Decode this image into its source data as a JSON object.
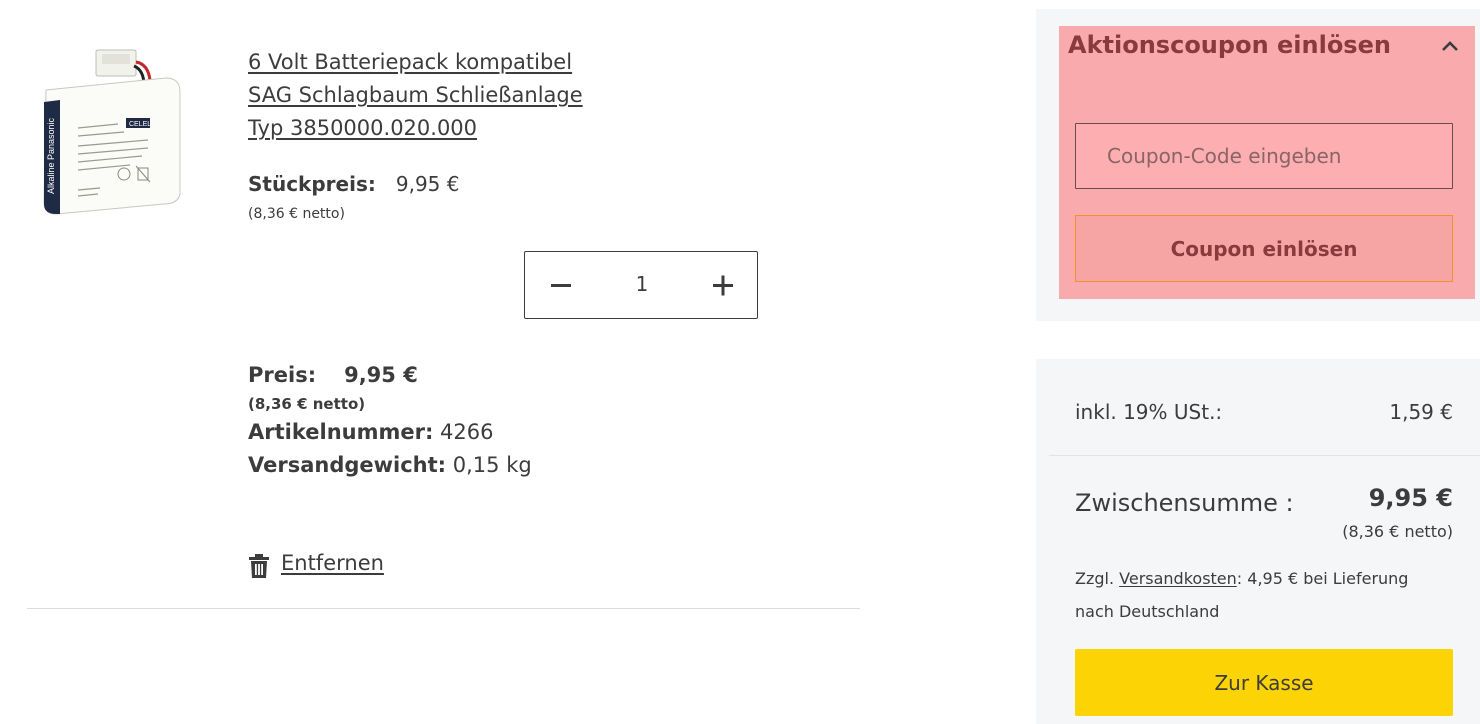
{
  "cart_item": {
    "title": "6 Volt Batteriepack kompatibel SAG Schlagbaum Schließanlage Typ 3850000.020.000",
    "image_label": "CELEL",
    "image_brand": "Alkaline Panasonic",
    "unit_price_label": "Stückpreis:",
    "unit_price_value": "9,95 €",
    "unit_price_net": "(8,36 € netto)",
    "quantity": {
      "minus_symbol": "−",
      "value": "1",
      "plus_symbol": "+"
    },
    "price_label": "Preis:",
    "price_value": "9,95 €",
    "price_net": "(8,36 € netto)",
    "article_number_label": "Artikelnummer:",
    "article_number_value": "4266",
    "shipping_weight_label": "Versandgewicht:",
    "shipping_weight_value": "0,15 kg",
    "remove_label": "Entfernen",
    "remove_icon": "trash-icon"
  },
  "coupon": {
    "title": "Aktionscoupon einlösen",
    "toggle_icon": "chevron-up-icon",
    "input_placeholder": "Coupon-Code eingeben",
    "input_value": "",
    "button_label": "Coupon einlösen"
  },
  "summary": {
    "tax_label": "inkl. 19% USt.:",
    "tax_value": "1,59 €",
    "subtotal_label": "Zwischensumme :",
    "subtotal_value": "9,95 €",
    "subtotal_net": "(8,36 € netto)",
    "shipping_prefix": "Zzgl.",
    "shipping_link": "Versandkosten",
    "shipping_suffix": ": 4,95 € bei Lieferung nach Deutschland",
    "checkout_label": "Zur Kasse"
  },
  "colors": {
    "highlight": "#f8aaac",
    "checkout_button": "#fcd405",
    "coupon_button_border": "#f0922b",
    "panel_background": "#f5f6f8"
  }
}
